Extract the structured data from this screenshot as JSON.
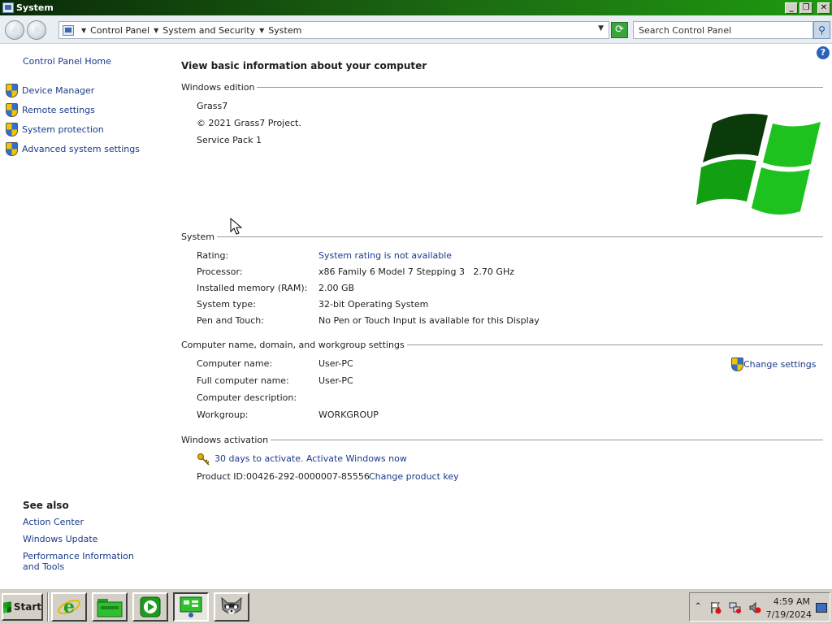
{
  "window": {
    "title": "System",
    "controls": [
      "minimize",
      "restore",
      "close"
    ]
  },
  "address": {
    "breadcrumbs": [
      "Control Panel",
      "System and Security",
      "System"
    ],
    "search_placeholder": "Search Control Panel"
  },
  "sidebar": {
    "home": "Control Panel Home",
    "tasks": [
      {
        "label": "Device Manager",
        "icon": "uac-shield-icon"
      },
      {
        "label": "Remote settings",
        "icon": "uac-shield-icon"
      },
      {
        "label": "System protection",
        "icon": "uac-shield-icon"
      },
      {
        "label": "Advanced system settings",
        "icon": "uac-shield-icon"
      }
    ],
    "see_also_title": "See also",
    "see_also": [
      "Action Center",
      "Windows Update",
      "Performance Information and Tools"
    ]
  },
  "main": {
    "title": "View basic information about your computer",
    "edition": {
      "heading": "Windows edition",
      "name": "Grass7",
      "copyright": "© 2021 Grass7 Project.",
      "service_pack": "Service Pack 1"
    },
    "system": {
      "heading": "System",
      "rows": [
        {
          "label": "Rating:",
          "value": "System rating is not available",
          "link": true
        },
        {
          "label": "Processor:",
          "value": "x86 Family 6 Model 7 Stepping 3   2.70 GHz",
          "link": false
        },
        {
          "label": "Installed memory (RAM):",
          "value": "2.00 GB",
          "link": false
        },
        {
          "label": "System type:",
          "value": "32-bit Operating System",
          "link": false
        },
        {
          "label": "Pen and Touch:",
          "value": "No Pen or Touch Input is available for this Display",
          "link": false
        }
      ]
    },
    "computer": {
      "heading": "Computer name, domain, and workgroup settings",
      "change_settings": "Change settings",
      "rows": [
        {
          "label": "Computer name:",
          "value": "User-PC"
        },
        {
          "label": "Full computer name:",
          "value": "User-PC"
        },
        {
          "label": "Computer description:",
          "value": ""
        },
        {
          "label": "Workgroup:",
          "value": "WORKGROUP"
        }
      ]
    },
    "activation": {
      "heading": "Windows activation",
      "status_link": "30 days to activate. Activate Windows now",
      "product_id_label": "Product ID:",
      "product_id": "00426-292-0000007-85556",
      "change_key": "Change product key"
    }
  },
  "taskbar": {
    "start_label": "Start",
    "apps": [
      "internet-explorer-icon",
      "file-explorer-icon",
      "media-player-icon",
      "control-panel-icon",
      "raccoon-app-icon"
    ],
    "clock_time": "4:59 AM",
    "clock_date": "7/19/2024"
  },
  "colors": {
    "title_bar": "#1c6a12",
    "link": "#1a3a8a",
    "logo_dark": "#0b3a0b",
    "logo_light": "#1ec21e"
  }
}
